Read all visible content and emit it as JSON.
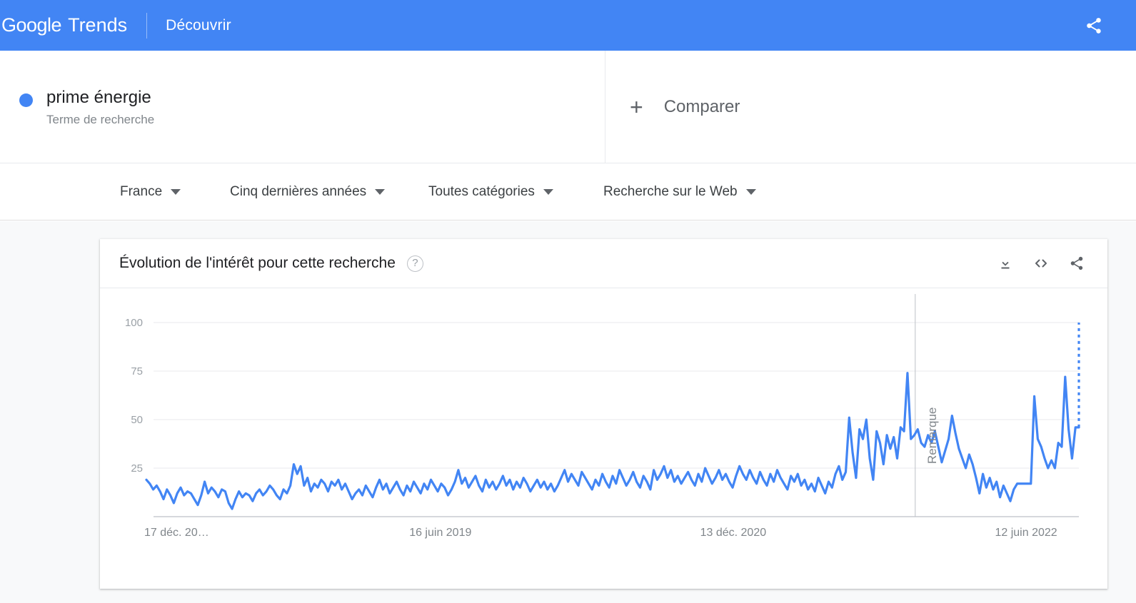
{
  "appbar": {
    "brand_google": "Google",
    "brand_trends": "Trends",
    "discover_label": "Découvrir",
    "share_icon": "share-icon",
    "bg_color": "#4285f4"
  },
  "term": {
    "dot_color": "#4285f4",
    "title": "prime énergie",
    "subtitle": "Terme de recherche"
  },
  "compare": {
    "plus": "+",
    "label": "Comparer"
  },
  "filters": [
    {
      "label": "France",
      "name": "filter-region"
    },
    {
      "label": "Cinq dernières années",
      "name": "filter-timerange"
    },
    {
      "label": "Toutes catégories",
      "name": "filter-category"
    },
    {
      "label": "Recherche sur le Web",
      "name": "filter-searchtype"
    }
  ],
  "card": {
    "title": "Évolution de l'intérêt pour cette recherche",
    "help_icon": "?",
    "tools": [
      {
        "name": "download-icon",
        "label": "download"
      },
      {
        "name": "embed-code-icon",
        "label": "<>"
      },
      {
        "name": "share-icon",
        "label": "share"
      }
    ]
  },
  "chart_data": {
    "type": "line",
    "title": "Évolution de l'intérêt pour cette recherche",
    "xlabel": "",
    "ylabel": "",
    "ylim": [
      0,
      100
    ],
    "yticks": [
      25,
      50,
      75,
      100
    ],
    "grid": true,
    "legend": false,
    "line_color": "#4285f4",
    "xticks": [
      "17 déc. 20…",
      "16 juin 2019",
      "13 déc. 2020",
      "12 juin 2022"
    ],
    "xtick_positions": [
      0,
      0.3153,
      0.6293,
      0.9434
    ],
    "annotation": {
      "label": "Remarque",
      "x_fraction": 0.8245,
      "line_color": "#bdc1c6"
    },
    "partial_data_tail": {
      "style": "dotted",
      "from_value": 46,
      "to_value": 100
    },
    "series": [
      {
        "name": "prime énergie",
        "values": [
          19,
          17,
          14,
          16,
          13,
          9,
          14,
          11,
          7,
          12,
          15,
          11,
          13,
          12,
          9,
          6,
          11,
          18,
          12,
          15,
          13,
          10,
          14,
          13,
          7,
          4,
          9,
          13,
          10,
          12,
          11,
          8,
          12,
          14,
          11,
          13,
          16,
          14,
          11,
          9,
          14,
          12,
          16,
          27,
          22,
          26,
          16,
          20,
          13,
          17,
          15,
          19,
          17,
          13,
          18,
          16,
          19,
          14,
          17,
          13,
          9,
          12,
          14,
          11,
          16,
          13,
          10,
          15,
          19,
          14,
          17,
          12,
          15,
          18,
          14,
          11,
          16,
          13,
          18,
          15,
          12,
          17,
          14,
          19,
          16,
          13,
          17,
          15,
          11,
          14,
          18,
          24,
          17,
          20,
          15,
          18,
          21,
          16,
          13,
          19,
          15,
          18,
          14,
          17,
          21,
          16,
          19,
          14,
          18,
          15,
          20,
          17,
          13,
          16,
          19,
          15,
          18,
          14,
          17,
          13,
          16,
          20,
          24,
          18,
          22,
          19,
          16,
          23,
          20,
          17,
          14,
          19,
          16,
          22,
          18,
          15,
          21,
          17,
          24,
          20,
          16,
          19,
          23,
          18,
          15,
          21,
          18,
          14,
          24,
          19,
          22,
          26,
          20,
          24,
          18,
          21,
          17,
          20,
          23,
          19,
          16,
          22,
          18,
          25,
          21,
          17,
          20,
          24,
          19,
          22,
          18,
          15,
          21,
          26,
          22,
          19,
          24,
          20,
          17,
          23,
          19,
          16,
          22,
          18,
          24,
          20,
          17,
          14,
          21,
          18,
          22,
          16,
          19,
          14,
          17,
          13,
          20,
          16,
          12,
          18,
          15,
          22,
          26,
          19,
          23,
          51,
          33,
          20,
          45,
          40,
          50,
          30,
          19,
          44,
          38,
          27,
          42,
          35,
          41,
          30,
          46,
          44,
          74,
          40,
          42,
          45,
          38,
          36,
          42,
          38,
          44,
          36,
          28,
          34,
          40,
          52,
          43,
          35,
          30,
          25,
          32,
          27,
          20,
          12,
          22,
          15,
          20,
          14,
          18,
          10,
          16,
          12,
          8,
          14,
          17,
          17,
          17,
          17,
          17,
          62,
          40,
          36,
          30,
          25,
          29,
          25,
          38,
          36,
          72,
          45,
          30,
          46,
          46
        ]
      }
    ]
  }
}
